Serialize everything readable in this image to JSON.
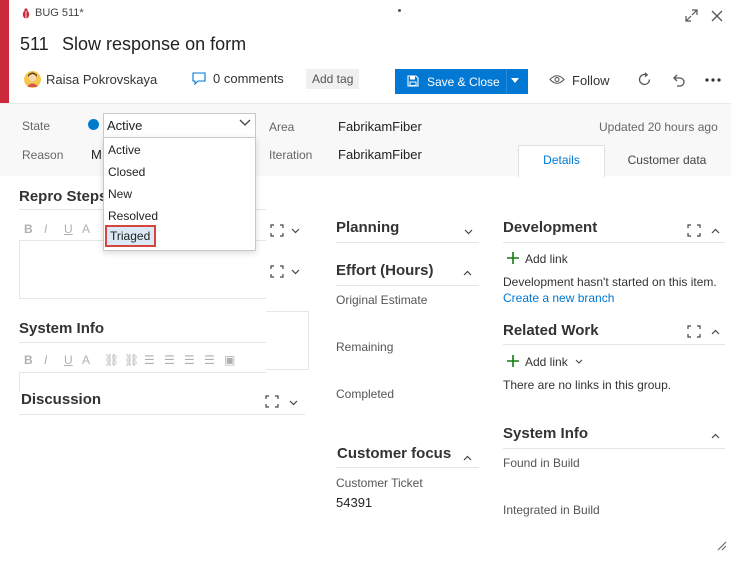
{
  "header": {
    "work_item_type": "BUG 511*",
    "id": "511",
    "title": "Slow response on form",
    "assigned_to": "Raisa Pokrovskaya",
    "comments": "0 comments",
    "add_tag": "Add tag",
    "save_close": "Save & Close",
    "follow": "Follow",
    "accent_color": "#cc293d"
  },
  "fields": {
    "state_label": "State",
    "state_value": "Active",
    "reason_label": "Reason",
    "reason_value": "M",
    "area_label": "Area",
    "area_value": "FabrikamFiber",
    "iteration_label": "Iteration",
    "iteration_value": "FabrikamFiber",
    "updated": "Updated 20 hours ago"
  },
  "state_dropdown": {
    "options": [
      "Active",
      "Closed",
      "New",
      "Resolved",
      "Triaged"
    ],
    "highlighted": "Triaged"
  },
  "tabs": [
    {
      "label": "Details",
      "active": true
    },
    {
      "label": "Customer data",
      "active": false
    }
  ],
  "left_column": {
    "repro_steps": "Repro Steps",
    "system_info": "System Info",
    "discussion": "Discussion"
  },
  "middle_column": {
    "planning": "Planning",
    "effort": "Effort (Hours)",
    "original_estimate": "Original Estimate",
    "remaining": "Remaining",
    "completed": "Completed",
    "customer_focus": "Customer focus",
    "customer_ticket_label": "Customer Ticket",
    "customer_ticket_value": "54391"
  },
  "right_column": {
    "development": "Development",
    "add_link": "Add link",
    "dev_message": "Development hasn't started on this item.",
    "create_branch": "Create a new branch",
    "related_work": "Related Work",
    "add_link_2": "Add link",
    "related_message": "There are no links in this group.",
    "system_info": "System Info",
    "found_in_build": "Found in Build",
    "integrated_in_build": "Integrated in Build"
  }
}
